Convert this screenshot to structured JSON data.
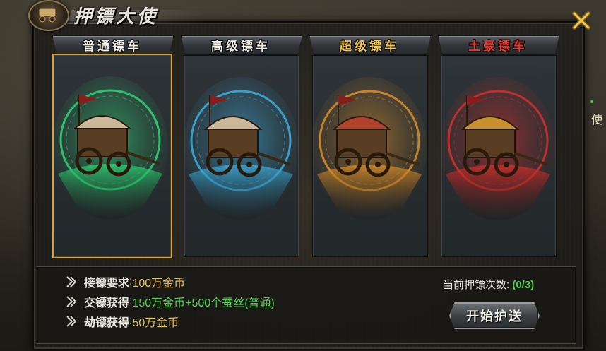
{
  "window": {
    "title": "押镖大使",
    "side_tab": "使"
  },
  "cards": [
    {
      "label": "普通镖车",
      "label_color": "#f4f1ea",
      "glow": "#2ee07a",
      "selected": true
    },
    {
      "label": "高级镖车",
      "label_color": "#f4f1ea",
      "glow": "#3fb6e8",
      "selected": false
    },
    {
      "label": "超级镖车",
      "label_color": "#f2c84b",
      "glow": "#e8962a",
      "selected": false
    },
    {
      "label": "土豪镖车",
      "label_color": "#e23a2e",
      "glow": "#e0302c",
      "selected": false
    }
  ],
  "info": {
    "rows": [
      {
        "label": "接镖要求",
        "colon": ":",
        "value": "100万金币",
        "value_color": "yellow"
      },
      {
        "label": "交镖获得",
        "colon": ":",
        "value": "150万金币+500个蚕丝(普通)",
        "value_color": "green"
      },
      {
        "label": "劫镖获得",
        "colon": ":",
        "value": "50万金币",
        "value_color": "yellow"
      }
    ],
    "count_label": "当前押镖次数:",
    "count_value": "(0/3)",
    "start_button": "开始护送"
  },
  "colors": {
    "selected_border": "#d9a431",
    "value_yellow": "#e6c253",
    "value_green": "#4fd24f"
  }
}
